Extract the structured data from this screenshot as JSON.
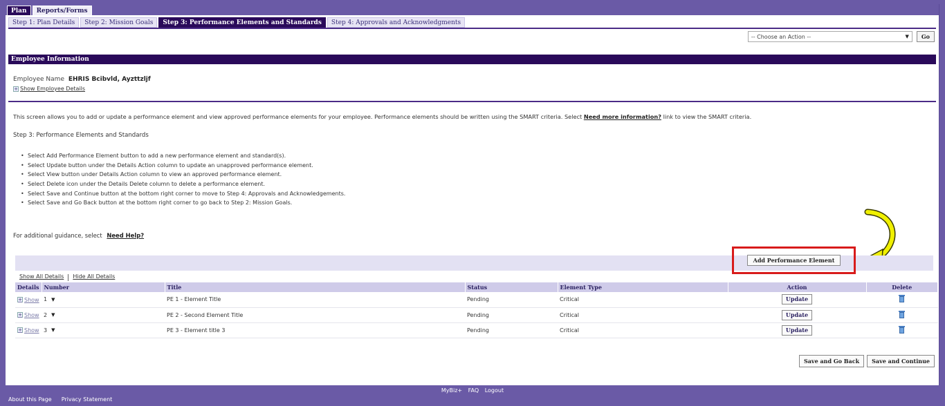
{
  "top_tabs": {
    "plan": "Plan",
    "reports": "Reports/Forms"
  },
  "step_tabs": [
    "Step 1: Plan Details",
    "Step 2: Mission Goals",
    "Step 3: Performance Elements and Standards",
    "Step 4: Approvals and Acknowledgments"
  ],
  "action": {
    "select_value": "-- Choose an Action --",
    "go": "Go"
  },
  "section_header": "Employee Information",
  "employee": {
    "label": "Employee Name",
    "name": "EHRIS Bcibvld, Ayzttzljf",
    "show_details": "Show Employee Details"
  },
  "intro": {
    "text_before": "This screen allows you to add or update a performance element and view approved performance elements for your employee. Performance elements should be written using the SMART criteria. Select",
    "link": "Need more information?",
    "text_after": "link to view the SMART criteria."
  },
  "step_title": "Step 3: Performance Elements and Standards",
  "bullets": [
    "Select Add Performance Element button to add a new performance element and standard(s).",
    "Select Update button under the Details Action column to update an unapproved performance element.",
    "Select View button under Details Action column to view an approved performance element.",
    "Select Delete icon under the Details Delete column to delete a performance element.",
    "Select Save and Continue button at the bottom right corner to move to Step 4: Approvals and Acknowledgements.",
    "Select Save and Go Back button at the bottom right corner to go back to Step 2: Mission Goals."
  ],
  "guidance": {
    "text": "For additional guidance, select",
    "link": "Need Help?"
  },
  "add_button": "Add Performance Element",
  "show_all": "Show All Details",
  "hide_all": "Hide All Details",
  "table": {
    "headers": [
      "Details",
      "Number",
      "Title",
      "Status",
      "Element Type",
      "Action",
      "Delete"
    ],
    "show_label": "Show",
    "update_label": "Update",
    "rows": [
      {
        "number": "1",
        "title": "PE 1 - Element Title",
        "status": "Pending",
        "type": "Critical"
      },
      {
        "number": "2",
        "title": "PE 2 - Second Element Title",
        "status": "Pending",
        "type": "Critical"
      },
      {
        "number": "3",
        "title": "PE 3 - Element title 3",
        "status": "Pending",
        "type": "Critical"
      }
    ]
  },
  "bottom": {
    "save_back": "Save and Go Back",
    "save_continue": "Save and Continue"
  },
  "footer": {
    "mybiz": "MyBiz+",
    "faq": "FAQ",
    "logout": "Logout",
    "about": "About this Page",
    "privacy": "Privacy Statement"
  }
}
